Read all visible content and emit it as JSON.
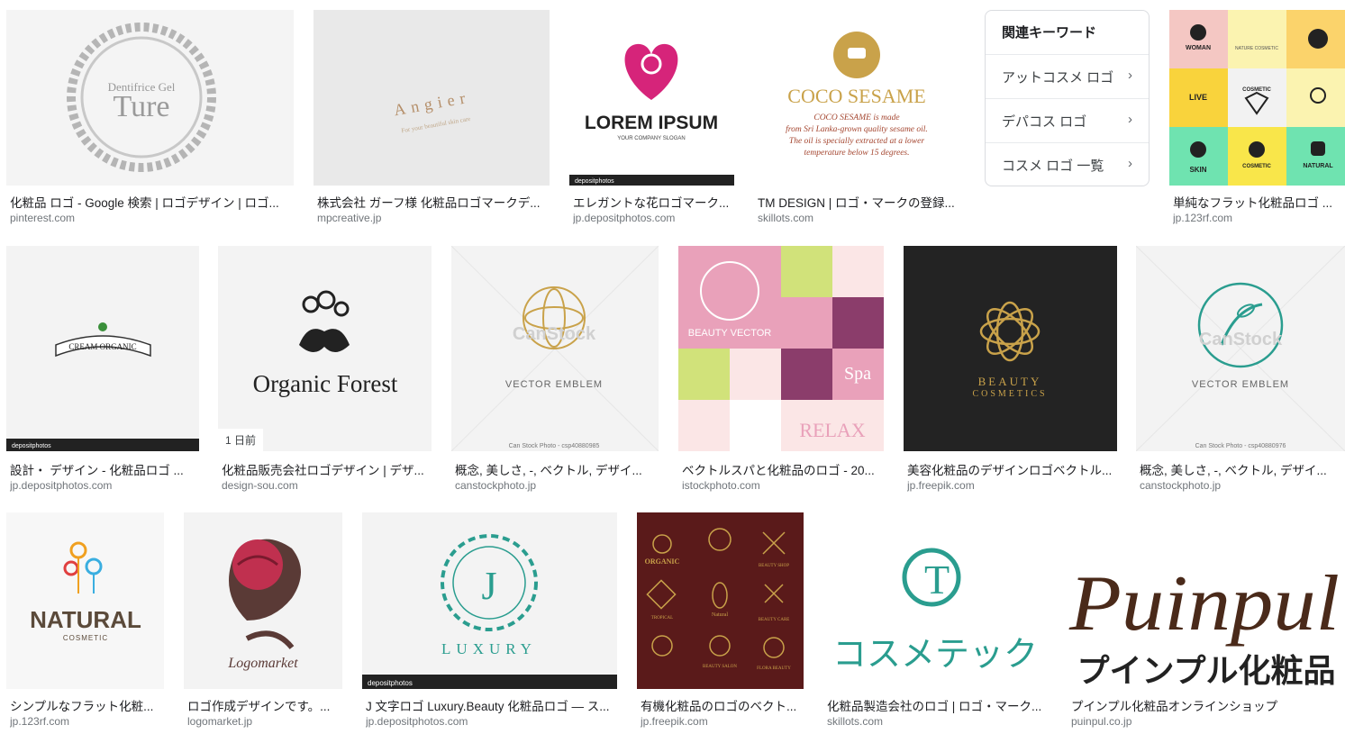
{
  "results": [
    {
      "caption": "化粧品 ロゴ - Google 検索 | ロゴデザイン | ロゴ...",
      "source": "pinterest.com",
      "logo_text": [
        "Dentifrice Gel",
        "Ture"
      ]
    },
    {
      "caption": "株式会社 ガーフ様 化粧品ロゴマークデ...",
      "source": "mpcreative.jp",
      "logo_text": [
        "Angier",
        "For your beautiful skin care"
      ]
    },
    {
      "caption": "エレガントな花ロゴマーク...",
      "source": "jp.depositphotos.com",
      "logo_text": [
        "LOREM IPSUM",
        "YOUR COMPANY SLOGAN",
        "depositphotos"
      ]
    },
    {
      "caption": "TM DESIGN | ロゴ・マークの登録...",
      "source": "skillots.com",
      "logo_text": [
        "COCO SESAME",
        "COCO SESAME is made",
        "from Sri Lanka-grown quality sesame oil.",
        "The oil is specially extracted at a lower",
        "temperature below 15 degrees."
      ]
    },
    {
      "caption": "単純なフラット化粧品ロゴ ...",
      "source": "jp.123rf.com",
      "logo_text": [
        "WOMAN",
        "NATURE COSMETIC",
        "LIVE",
        "COSMETIC",
        "SKIN",
        "COSMETIC",
        "NATURAL"
      ]
    },
    {
      "caption": "設計・ デザイン - 化粧品ロゴ ...",
      "source": "jp.depositphotos.com",
      "logo_text": [
        "CREAM ORGANIC",
        "depositphotos"
      ]
    },
    {
      "caption": "化粧品販売会社ロゴデザイン | デザ...",
      "source": "design-sou.com",
      "badge": "1 日前",
      "logo_text": [
        "Organic Forest"
      ]
    },
    {
      "caption": "概念, 美しさ, -, ベクトル, デザイ...",
      "source": "canstockphoto.jp",
      "logo_text": [
        "VECTOR EMBLEM",
        "Can Stock Photo - csp40880985",
        "CanStock"
      ]
    },
    {
      "caption": "ベクトルスパと化粧品のロゴ - 20...",
      "source": "istockphoto.com",
      "logo_text": [
        "BEAUTY VECTOR",
        "Spa",
        "RELAX"
      ]
    },
    {
      "caption": "美容化粧品のデザインロゴベクトル...",
      "source": "jp.freepik.com",
      "logo_text": [
        "BEAUTY",
        "COSMETICS"
      ]
    },
    {
      "caption": "概念, 美しさ, -, ベクトル, デザイ...",
      "source": "canstockphoto.jp",
      "logo_text": [
        "VECTOR EMBLEM",
        "Can Stock Photo - csp40880976",
        "CanStock"
      ]
    },
    {
      "caption": "シンプルなフラット化粧...",
      "source": "jp.123rf.com",
      "logo_text": [
        "NATURAL",
        "COSMETIC"
      ]
    },
    {
      "caption": "ロゴ作成デザインです。...",
      "source": "logomarket.jp",
      "logo_text": [
        "Logomarket"
      ]
    },
    {
      "caption": "J 文字ロゴ Luxury.Beauty 化粧品ロゴ — ス...",
      "source": "jp.depositphotos.com",
      "logo_text": [
        "J",
        "LUXURY",
        "depositphotos"
      ]
    },
    {
      "caption": "有機化粧品のロゴのベクト...",
      "source": "jp.freepik.com",
      "logo_text": [
        "ORGANIC",
        "BEAUTY SHOP",
        "TROPICAL",
        "Natural",
        "BEAUTY CARE",
        "BEAUTY SALON",
        "FLORA BEAUTY"
      ]
    },
    {
      "caption": "化粧品製造会社のロゴ | ロゴ・マーク...",
      "source": "skillots.com",
      "logo_text": [
        "T",
        "コスメテック"
      ]
    },
    {
      "caption": "プインプル化粧品オンラインショップ",
      "source": "puinpul.co.jp",
      "logo_text": [
        "Puinpul",
        "プインプル化粧品"
      ]
    }
  ],
  "related_keywords": {
    "title": "関連キーワード",
    "items": [
      {
        "label": "アットコスメ ロゴ",
        "icon": "chevron-right-icon"
      },
      {
        "label": "デパコス ロゴ",
        "icon": "chevron-right-icon"
      },
      {
        "label": "コスメ ロゴ 一覧",
        "icon": "chevron-right-icon"
      }
    ]
  },
  "colors": {
    "caption": "#202124",
    "source": "#70757a",
    "gold": "#c9a24a",
    "teal": "#2a9d8f",
    "maroon": "#5a1a1a",
    "pink": "#d6247a",
    "rose": "#c0304f"
  }
}
